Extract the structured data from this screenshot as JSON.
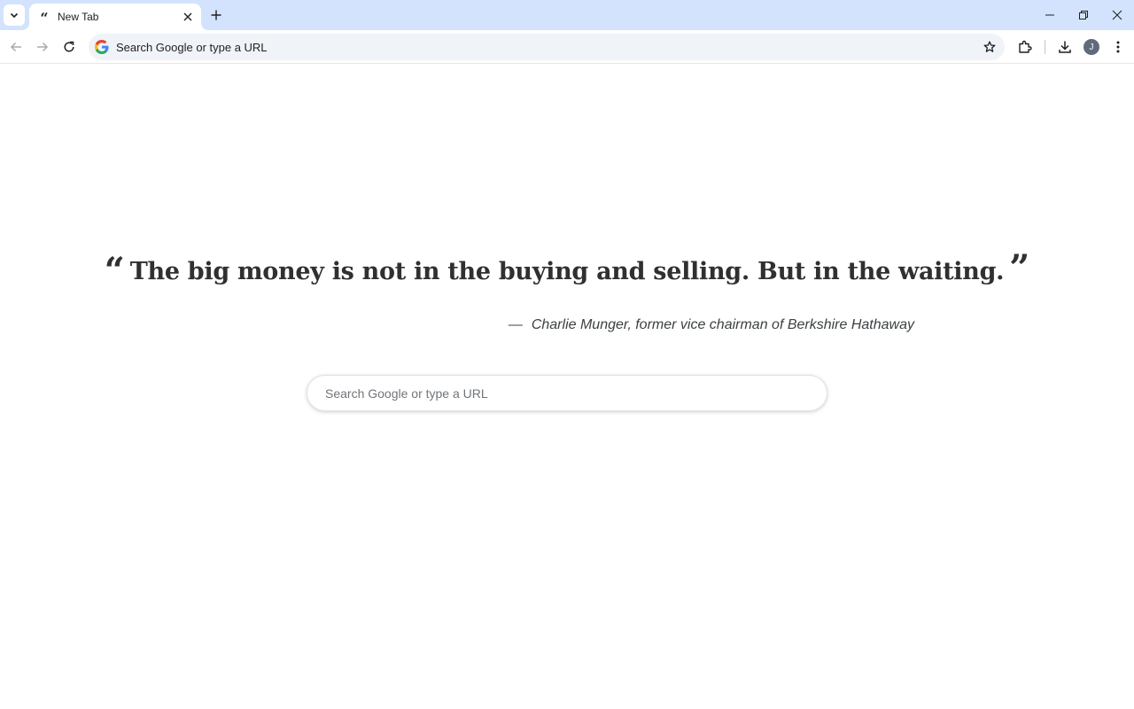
{
  "browser": {
    "tab": {
      "title": "New Tab",
      "favicon": "quote-icon"
    },
    "omnibox": {
      "text": "Search Google or type a URL"
    },
    "profile_initial": "J"
  },
  "page": {
    "quote": {
      "open_mark": "“",
      "text": "The big money is not in the buying and selling. But in the waiting.",
      "close_mark": "”",
      "dash": "—",
      "author": "Charlie Munger, former vice chairman of Berkshire Hathaway"
    },
    "search": {
      "placeholder": "Search Google or type a URL"
    }
  },
  "colors": {
    "tabstrip": "#d3e3fd",
    "omnibox": "#f0f4f9",
    "quote_text": "#303030"
  }
}
